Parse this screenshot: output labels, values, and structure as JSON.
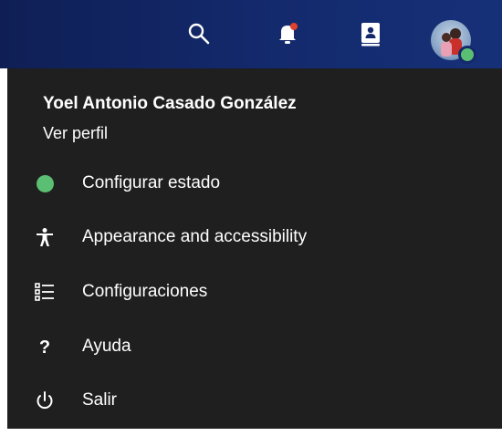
{
  "header": {
    "icons": [
      "search-icon",
      "bell-icon",
      "contact-card-icon"
    ],
    "notification_dot_color": "#e0422b",
    "status_color": "#5bbf73"
  },
  "profile": {
    "name": "Yoel Antonio Casado González",
    "view_profile": "Ver perfil"
  },
  "menu": {
    "items": [
      {
        "label": "Configurar estado",
        "icon": "status-dot-icon"
      },
      {
        "label": "Appearance and accessibility",
        "icon": "accessibility-icon"
      },
      {
        "label": "Configuraciones",
        "icon": "settings-list-icon"
      },
      {
        "label": "Ayuda",
        "icon": "help-icon"
      },
      {
        "label": "Salir",
        "icon": "power-icon"
      }
    ]
  }
}
